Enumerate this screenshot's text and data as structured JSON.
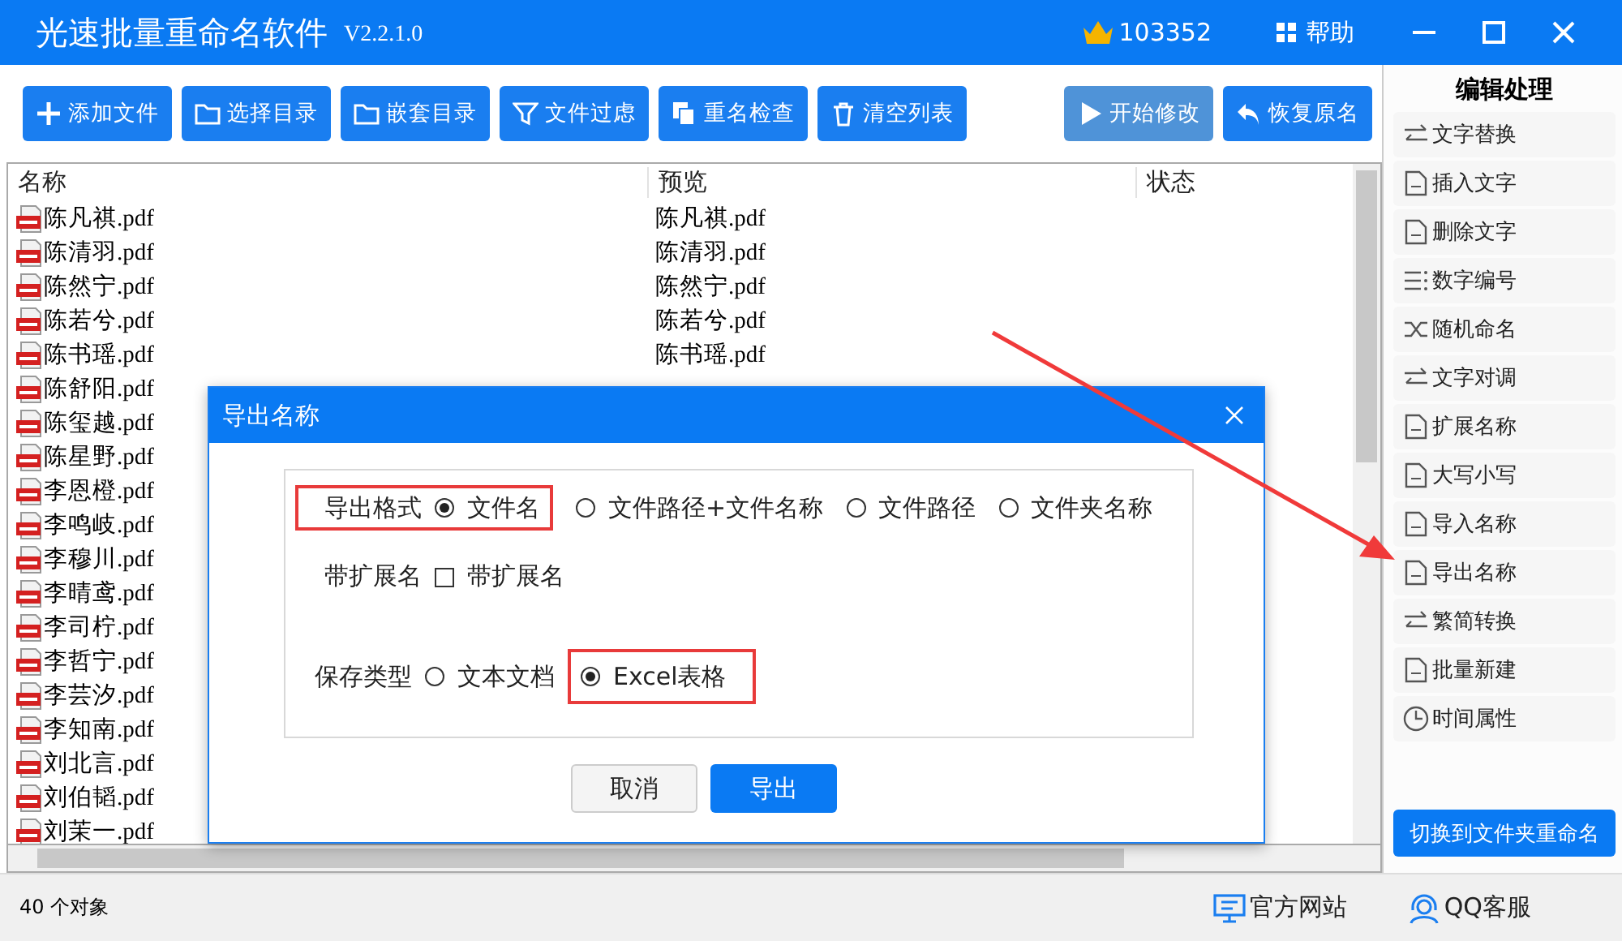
{
  "window": {
    "title": "光速批量重命名软件",
    "version": "V2.2.1.0",
    "account": "103352",
    "help": "帮助"
  },
  "toolbar": [
    {
      "label": "添加文件",
      "disabled": false
    },
    {
      "label": "选择目录",
      "disabled": false
    },
    {
      "label": "嵌套目录",
      "disabled": false
    },
    {
      "label": "文件过虑",
      "disabled": false
    },
    {
      "label": "重名检查",
      "disabled": false
    },
    {
      "label": "清空列表",
      "disabled": false
    },
    {
      "label": "开始修改",
      "disabled": true
    },
    {
      "label": "恢复原名",
      "disabled": false
    }
  ],
  "table": {
    "columns": [
      "名称",
      "预览",
      "状态"
    ],
    "rows": [
      {
        "name": "陈凡祺.pdf",
        "preview": "陈凡祺.pdf"
      },
      {
        "name": "陈清羽.pdf",
        "preview": "陈清羽.pdf"
      },
      {
        "name": "陈然宁.pdf",
        "preview": "陈然宁.pdf"
      },
      {
        "name": "陈若兮.pdf",
        "preview": "陈若兮.pdf"
      },
      {
        "name": "陈书瑶.pdf",
        "preview": "陈书瑶.pdf"
      },
      {
        "name": "陈舒阳.pdf"
      },
      {
        "name": "陈玺越.pdf"
      },
      {
        "name": "陈星野.pdf"
      },
      {
        "name": "李恩橙.pdf"
      },
      {
        "name": "李鸣岐.pdf"
      },
      {
        "name": "李穆川.pdf"
      },
      {
        "name": "李晴鸢.pdf"
      },
      {
        "name": "李司柠.pdf"
      },
      {
        "name": "李哲宁.pdf"
      },
      {
        "name": "李芸汐.pdf"
      },
      {
        "name": "李知南.pdf"
      },
      {
        "name": "刘北言.pdf"
      },
      {
        "name": "刘伯韬.pdf"
      },
      {
        "name": "刘茉一.pdf"
      }
    ]
  },
  "sidebar": {
    "title": "编辑处理",
    "items": [
      "文字替换",
      "插入文字",
      "删除文字",
      "数字编号",
      "随机命名",
      "文字对调",
      "扩展名称",
      "大写小写",
      "导入名称",
      "导出名称",
      "繁简转换",
      "批量新建",
      "时间属性"
    ],
    "switch_button": "切换到文件夹重命名"
  },
  "dialog": {
    "title": "导出名称",
    "format": {
      "label": "导出格式",
      "options": [
        {
          "label": "文件名",
          "selected": true
        },
        {
          "label": "文件路径+文件名称",
          "selected": false
        },
        {
          "label": "文件路径",
          "selected": false
        },
        {
          "label": "文件夹名称",
          "selected": false
        }
      ]
    },
    "extension": {
      "label": "带扩展名",
      "checkbox": "带扩展名",
      "checked": false
    },
    "save_type": {
      "label": "保存类型",
      "options": [
        {
          "label": "文本文档",
          "selected": false
        },
        {
          "label": "Excel表格",
          "selected": true
        }
      ]
    },
    "buttons": [
      {
        "label": "取消",
        "kind": "secondary"
      },
      {
        "label": "导出",
        "kind": "primary"
      }
    ]
  },
  "status_bar": {
    "count": "40 个对象",
    "links": [
      "官方网站",
      "QQ客服"
    ]
  }
}
